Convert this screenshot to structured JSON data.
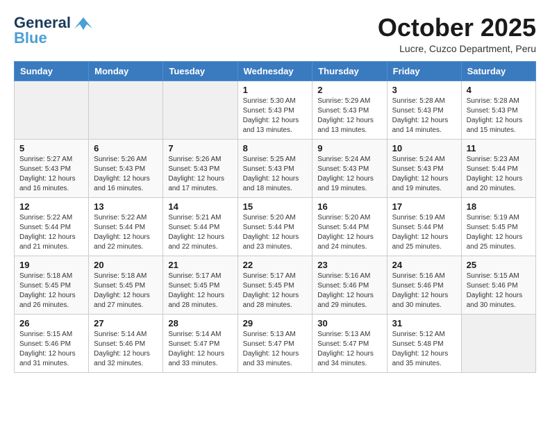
{
  "header": {
    "logo_line1": "General",
    "logo_line2": "Blue",
    "month": "October 2025",
    "location": "Lucre, Cuzco Department, Peru"
  },
  "days_of_week": [
    "Sunday",
    "Monday",
    "Tuesday",
    "Wednesday",
    "Thursday",
    "Friday",
    "Saturday"
  ],
  "weeks": [
    [
      {
        "num": "",
        "info": ""
      },
      {
        "num": "",
        "info": ""
      },
      {
        "num": "",
        "info": ""
      },
      {
        "num": "1",
        "info": "Sunrise: 5:30 AM\nSunset: 5:43 PM\nDaylight: 12 hours\nand 13 minutes."
      },
      {
        "num": "2",
        "info": "Sunrise: 5:29 AM\nSunset: 5:43 PM\nDaylight: 12 hours\nand 13 minutes."
      },
      {
        "num": "3",
        "info": "Sunrise: 5:28 AM\nSunset: 5:43 PM\nDaylight: 12 hours\nand 14 minutes."
      },
      {
        "num": "4",
        "info": "Sunrise: 5:28 AM\nSunset: 5:43 PM\nDaylight: 12 hours\nand 15 minutes."
      }
    ],
    [
      {
        "num": "5",
        "info": "Sunrise: 5:27 AM\nSunset: 5:43 PM\nDaylight: 12 hours\nand 16 minutes."
      },
      {
        "num": "6",
        "info": "Sunrise: 5:26 AM\nSunset: 5:43 PM\nDaylight: 12 hours\nand 16 minutes."
      },
      {
        "num": "7",
        "info": "Sunrise: 5:26 AM\nSunset: 5:43 PM\nDaylight: 12 hours\nand 17 minutes."
      },
      {
        "num": "8",
        "info": "Sunrise: 5:25 AM\nSunset: 5:43 PM\nDaylight: 12 hours\nand 18 minutes."
      },
      {
        "num": "9",
        "info": "Sunrise: 5:24 AM\nSunset: 5:43 PM\nDaylight: 12 hours\nand 19 minutes."
      },
      {
        "num": "10",
        "info": "Sunrise: 5:24 AM\nSunset: 5:43 PM\nDaylight: 12 hours\nand 19 minutes."
      },
      {
        "num": "11",
        "info": "Sunrise: 5:23 AM\nSunset: 5:44 PM\nDaylight: 12 hours\nand 20 minutes."
      }
    ],
    [
      {
        "num": "12",
        "info": "Sunrise: 5:22 AM\nSunset: 5:44 PM\nDaylight: 12 hours\nand 21 minutes."
      },
      {
        "num": "13",
        "info": "Sunrise: 5:22 AM\nSunset: 5:44 PM\nDaylight: 12 hours\nand 22 minutes."
      },
      {
        "num": "14",
        "info": "Sunrise: 5:21 AM\nSunset: 5:44 PM\nDaylight: 12 hours\nand 22 minutes."
      },
      {
        "num": "15",
        "info": "Sunrise: 5:20 AM\nSunset: 5:44 PM\nDaylight: 12 hours\nand 23 minutes."
      },
      {
        "num": "16",
        "info": "Sunrise: 5:20 AM\nSunset: 5:44 PM\nDaylight: 12 hours\nand 24 minutes."
      },
      {
        "num": "17",
        "info": "Sunrise: 5:19 AM\nSunset: 5:44 PM\nDaylight: 12 hours\nand 25 minutes."
      },
      {
        "num": "18",
        "info": "Sunrise: 5:19 AM\nSunset: 5:45 PM\nDaylight: 12 hours\nand 25 minutes."
      }
    ],
    [
      {
        "num": "19",
        "info": "Sunrise: 5:18 AM\nSunset: 5:45 PM\nDaylight: 12 hours\nand 26 minutes."
      },
      {
        "num": "20",
        "info": "Sunrise: 5:18 AM\nSunset: 5:45 PM\nDaylight: 12 hours\nand 27 minutes."
      },
      {
        "num": "21",
        "info": "Sunrise: 5:17 AM\nSunset: 5:45 PM\nDaylight: 12 hours\nand 28 minutes."
      },
      {
        "num": "22",
        "info": "Sunrise: 5:17 AM\nSunset: 5:45 PM\nDaylight: 12 hours\nand 28 minutes."
      },
      {
        "num": "23",
        "info": "Sunrise: 5:16 AM\nSunset: 5:46 PM\nDaylight: 12 hours\nand 29 minutes."
      },
      {
        "num": "24",
        "info": "Sunrise: 5:16 AM\nSunset: 5:46 PM\nDaylight: 12 hours\nand 30 minutes."
      },
      {
        "num": "25",
        "info": "Sunrise: 5:15 AM\nSunset: 5:46 PM\nDaylight: 12 hours\nand 30 minutes."
      }
    ],
    [
      {
        "num": "26",
        "info": "Sunrise: 5:15 AM\nSunset: 5:46 PM\nDaylight: 12 hours\nand 31 minutes."
      },
      {
        "num": "27",
        "info": "Sunrise: 5:14 AM\nSunset: 5:46 PM\nDaylight: 12 hours\nand 32 minutes."
      },
      {
        "num": "28",
        "info": "Sunrise: 5:14 AM\nSunset: 5:47 PM\nDaylight: 12 hours\nand 33 minutes."
      },
      {
        "num": "29",
        "info": "Sunrise: 5:13 AM\nSunset: 5:47 PM\nDaylight: 12 hours\nand 33 minutes."
      },
      {
        "num": "30",
        "info": "Sunrise: 5:13 AM\nSunset: 5:47 PM\nDaylight: 12 hours\nand 34 minutes."
      },
      {
        "num": "31",
        "info": "Sunrise: 5:12 AM\nSunset: 5:48 PM\nDaylight: 12 hours\nand 35 minutes."
      },
      {
        "num": "",
        "info": ""
      }
    ]
  ]
}
